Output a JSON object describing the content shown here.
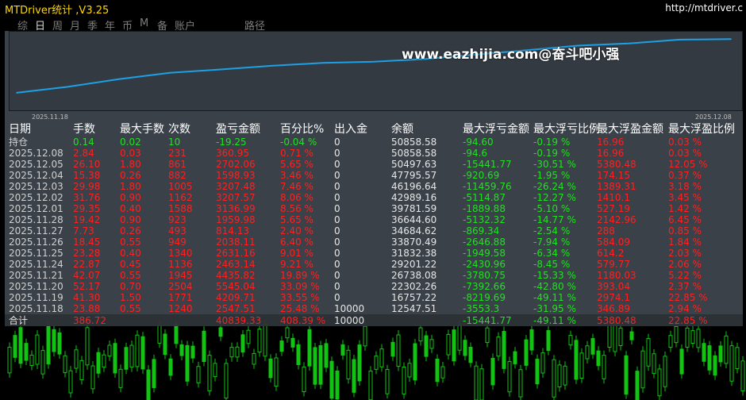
{
  "window": {
    "title": "MTDriver统计 ,V3.25",
    "url": "http://mtdriver.c"
  },
  "tabs": [
    {
      "label": "综",
      "active": false
    },
    {
      "label": "日",
      "active": true
    },
    {
      "label": "周",
      "active": false
    },
    {
      "label": "月",
      "active": false
    },
    {
      "label": "季",
      "active": false
    },
    {
      "label": "年",
      "active": false
    },
    {
      "label": "币",
      "active": false
    },
    {
      "label": "M",
      "active": false
    },
    {
      "label": "备",
      "active": false
    },
    {
      "label": "账户",
      "active": false
    },
    {
      "label": "路径",
      "active": false
    }
  ],
  "watermark": "www.eazhijia.com@奋斗吧小强",
  "equity_chart": {
    "start_date": "2025.11.18",
    "end_date": "2025.12.08",
    "line_color": "#1ea0e6"
  },
  "chart_data": {
    "type": "line",
    "x": [
      "2025.11.18",
      "2025.11.19",
      "2025.11.20",
      "2025.11.21",
      "2025.11.24",
      "2025.11.25",
      "2025.11.26",
      "2025.11.27",
      "2025.11.28",
      "2025.12.01",
      "2025.12.02",
      "2025.12.03",
      "2025.12.04",
      "2025.12.05",
      "2025.12.08"
    ],
    "y": [
      12547.51,
      16757.22,
      22302.26,
      26738.08,
      29201.22,
      31832.38,
      33870.49,
      34684.62,
      36644.6,
      39781.59,
      42989.16,
      46196.64,
      47795.57,
      50497.63,
      50858.58
    ],
    "title": "",
    "xlabel": "",
    "ylabel": ""
  },
  "table": {
    "headers": [
      "日期",
      "手数",
      "最大手数",
      "次数",
      "盈亏金额",
      "百分比%",
      "出入金",
      "余额",
      "最大浮亏金额",
      "最大浮亏比例",
      "最大浮盈金额",
      "最大浮盈比例"
    ],
    "holding": [
      "持仓",
      "0.14",
      "0.02",
      "10",
      "-19.25",
      "-0.04 %",
      "0",
      "50858.58",
      "-94.60",
      "-0.19 %",
      "16.96",
      "0.03 %"
    ],
    "rows": [
      [
        "2025.12.08",
        "2.84",
        "0.03",
        "231",
        "360.95",
        "0.71 %",
        "0",
        "50858.58",
        "-94.6",
        "-0.19 %",
        "16.96",
        "0.03 %"
      ],
      [
        "2025.12.05",
        "26.10",
        "1.80",
        "861",
        "2702.06",
        "5.65 %",
        "0",
        "50497.63",
        "-15441.77",
        "-30.51 %",
        "5380.48",
        "12.05 %"
      ],
      [
        "2025.12.04",
        "15.38",
        "0.26",
        "882",
        "1598.93",
        "3.46 %",
        "0",
        "47795.57",
        "-920.69",
        "-1.95 %",
        "174.15",
        "0.37 %"
      ],
      [
        "2025.12.03",
        "29.98",
        "1.80",
        "1005",
        "3207.48",
        "7.46 %",
        "0",
        "46196.64",
        "-11459.76",
        "-26.24 %",
        "1389.31",
        "3.18 %"
      ],
      [
        "2025.12.02",
        "31.76",
        "0.90",
        "1162",
        "3207.57",
        "8.06 %",
        "0",
        "42989.16",
        "-5114.87",
        "-12.27 %",
        "1410.1",
        "3.45 %"
      ],
      [
        "2025.12.01",
        "29.35",
        "0.40",
        "1588",
        "3136.99",
        "8.56 %",
        "0",
        "39781.59",
        "-1889.88",
        "-5.10 %",
        "527.19",
        "1.42 %"
      ],
      [
        "2025.11.28",
        "19.42",
        "0.90",
        "923",
        "1959.98",
        "5.65 %",
        "0",
        "36644.60",
        "-5132.32",
        "-14.77 %",
        "2142.96",
        "6.45 %"
      ],
      [
        "2025.11.27",
        "7.73",
        "0.26",
        "493",
        "814.13",
        "2.40 %",
        "0",
        "34684.62",
        "-869.34",
        "-2.54 %",
        "288",
        "0.85 %"
      ],
      [
        "2025.11.26",
        "18.45",
        "0.55",
        "949",
        "2038.11",
        "6.40 %",
        "0",
        "33870.49",
        "-2646.88",
        "-7.94 %",
        "584.09",
        "1.84 %"
      ],
      [
        "2025.11.25",
        "23.28",
        "0.40",
        "1340",
        "2631.16",
        "9.01 %",
        "0",
        "31832.38",
        "-1949.58",
        "-6.34 %",
        "614.2",
        "2.03 %"
      ],
      [
        "2025.11.24",
        "22.87",
        "0.45",
        "1136",
        "2463.14",
        "9.21 %",
        "0",
        "29201.22",
        "-2430.96",
        "-8.45 %",
        "579.77",
        "2.06 %"
      ],
      [
        "2025.11.21",
        "42.07",
        "0.55",
        "1945",
        "4435.82",
        "19.89 %",
        "0",
        "26738.08",
        "-3780.75",
        "-15.33 %",
        "1180.03",
        "5.22 %"
      ],
      [
        "2025.11.20",
        "52.17",
        "0.70",
        "2504",
        "5545.04",
        "33.09 %",
        "0",
        "22302.26",
        "-7392.66",
        "-42.80 %",
        "393.04",
        "2.37 %"
      ],
      [
        "2025.11.19",
        "41.30",
        "1.50",
        "1771",
        "4209.71",
        "33.55 %",
        "0",
        "16757.22",
        "-8219.69",
        "-49.11 %",
        "2974.1",
        "22.85 %"
      ],
      [
        "2025.11.18",
        "23.88",
        "0.55",
        "1240",
        "2547.51",
        "25.48 %",
        "10000",
        "12547.51",
        "-3553.3",
        "-31.95 %",
        "346.89",
        "2.94 %"
      ]
    ],
    "total": [
      "合计",
      "386.72",
      "",
      "",
      "40839.33",
      "408.39 %",
      "10000",
      "",
      "-15441.77",
      "-49.11 %",
      "5380.48",
      "22.85 %"
    ]
  }
}
